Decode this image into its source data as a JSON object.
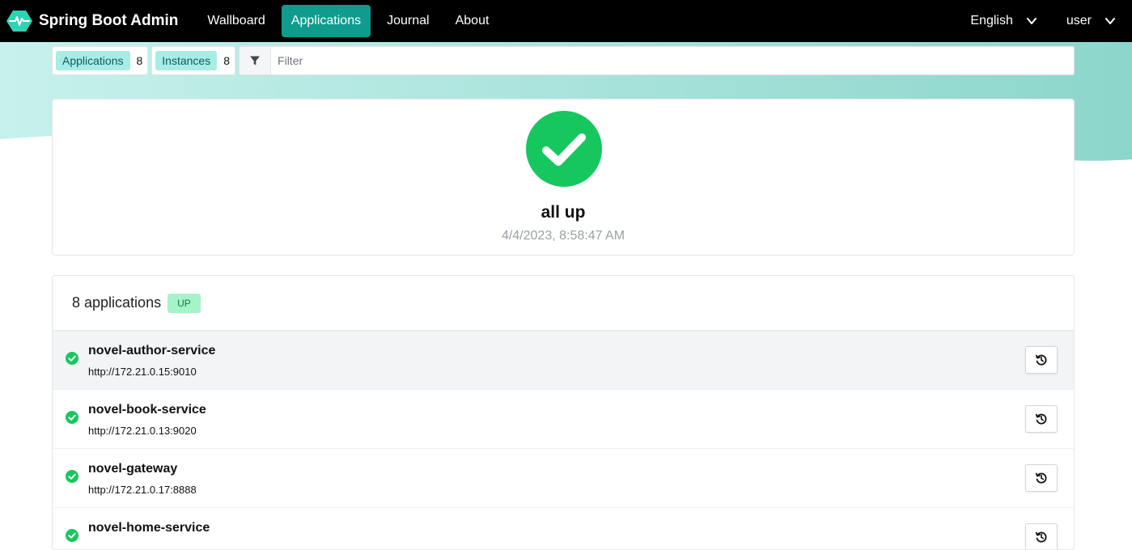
{
  "brand": {
    "title": "Spring Boot Admin",
    "logo_icon": "heartbeat-icon"
  },
  "nav": {
    "items": [
      {
        "label": "Wallboard",
        "active": false
      },
      {
        "label": "Applications",
        "active": true
      },
      {
        "label": "Journal",
        "active": false
      },
      {
        "label": "About",
        "active": false
      }
    ],
    "language": "English",
    "user": "user"
  },
  "toolbar": {
    "applications_label": "Applications",
    "applications_count": "8",
    "instances_label": "Instances",
    "instances_count": "8",
    "filter_placeholder": "Filter",
    "filter_icon": "funnel-icon"
  },
  "status": {
    "title": "all up",
    "timestamp": "4/4/2023, 8:58:47 AM",
    "icon": "check-circle-icon"
  },
  "applications": {
    "heading": "8 applications",
    "badge": "UP",
    "rows": [
      {
        "name": "novel-author-service",
        "url": "http://172.21.0.15:9010"
      },
      {
        "name": "novel-book-service",
        "url": "http://172.21.0.13:9020"
      },
      {
        "name": "novel-gateway",
        "url": "http://172.21.0.17:8888"
      },
      {
        "name": "novel-home-service",
        "url": ""
      }
    ]
  },
  "colors": {
    "accent": "#0f9b8e",
    "status_up": "#16c75d",
    "tag_bg": "#a8ece6",
    "badge_up_bg": "#a7f3c9"
  }
}
